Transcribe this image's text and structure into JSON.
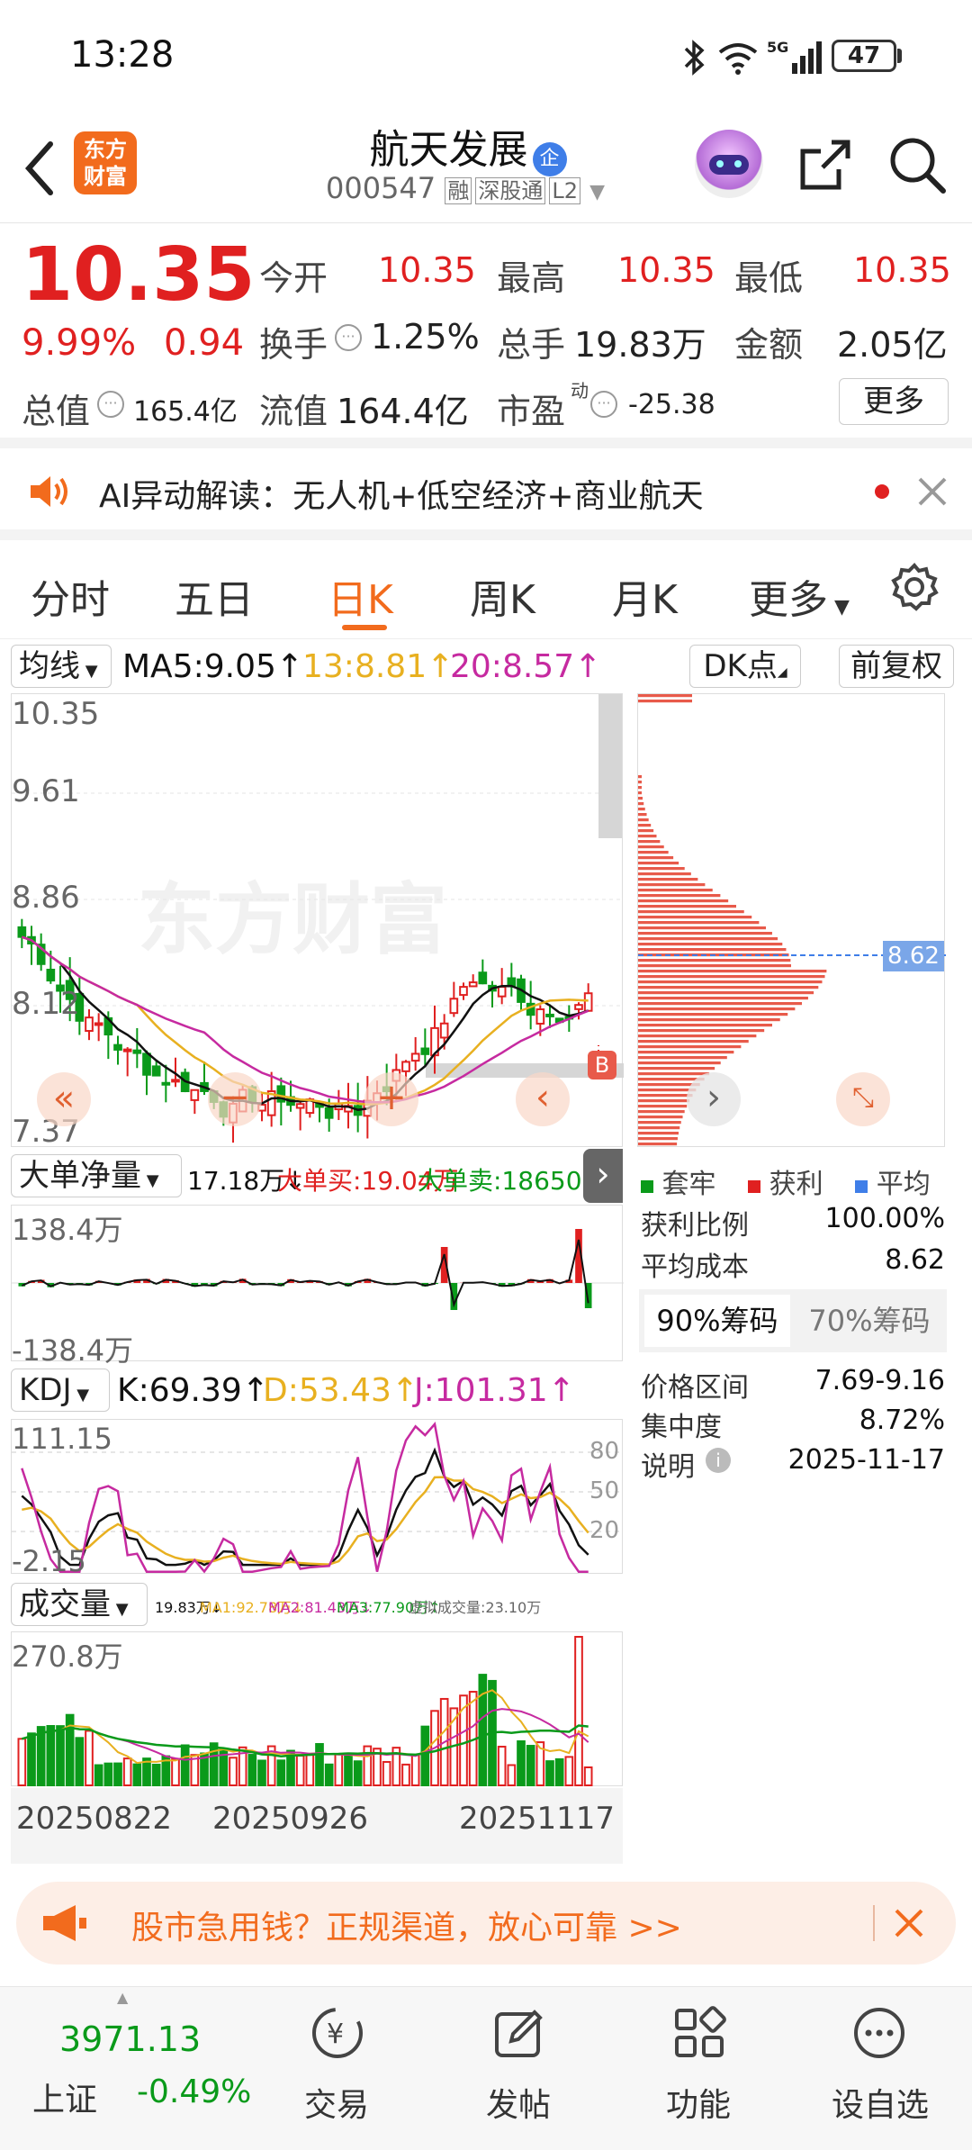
{
  "status": {
    "time": "13:28",
    "battery": "47"
  },
  "header": {
    "title": "航天发展",
    "title_badge": "企",
    "code": "000547",
    "tag1": "融",
    "tag2": "深股通",
    "tag3": "L2",
    "logo_l1": "东方",
    "logo_l2": "财富"
  },
  "quote": {
    "price": "10.35",
    "pct": "9.99%",
    "change": "0.94",
    "open_label": "今开",
    "open": "10.35",
    "high_label": "最高",
    "high": "10.35",
    "low_label": "最低",
    "low": "10.35",
    "turnover_label": "换手",
    "turnover": "1.25%",
    "volume_label": "总手",
    "volume": "19.83万",
    "amount_label": "金额",
    "amount": "2.05亿",
    "mcap_label": "总值",
    "mcap": "165.4亿",
    "float_label": "流值",
    "float": "164.4亿",
    "pe_label": "市盈",
    "pe_sup": "动",
    "pe": "-25.38",
    "more": "更多"
  },
  "ai_banner": {
    "text": "AI异动解读：无人机+低空经济+商业航天"
  },
  "tabs": [
    {
      "label": "分时",
      "active": false
    },
    {
      "label": "五日",
      "active": false
    },
    {
      "label": "日K",
      "active": true
    },
    {
      "label": "周K",
      "active": false
    },
    {
      "label": "月K",
      "active": false
    },
    {
      "label": "更多",
      "active": false
    }
  ],
  "ma_bar": {
    "select": "均线",
    "ma5": "MA5:9.05↑",
    "ma13": "13:8.81↑",
    "ma20": "20:8.57↑",
    "dk": "DK点",
    "fq": "前复权"
  },
  "price_axis": [
    "10.35",
    "9.61",
    "8.86",
    "8.12",
    "7.37"
  ],
  "watermark": "东方财富",
  "b_marker": "B",
  "bigorder": {
    "select": "大单净量",
    "net": "17.18万↓",
    "buy": "大单买:19.04万",
    "sell": "大单卖:18650",
    "top": "138.4万",
    "bottom": "-138.4万"
  },
  "kdj": {
    "select": "KDJ",
    "k": "K:69.39↑",
    "d": "D:53.43↑",
    "j": "J:101.31↑",
    "top": "111.15",
    "bottom": "-2.15",
    "lv80": "80",
    "lv50": "50",
    "lv20": "20"
  },
  "volume": {
    "select": "成交量",
    "vol": "19.83万↓",
    "ma1": "MA1:92.78万↓",
    "ma2": "MA2:81.43万↓",
    "ma3": "MA3:77.90万↑",
    "virtual": "虚拟成交量:23.10万",
    "top": "270.8万"
  },
  "dates": [
    "20250822",
    "20250926",
    "20251117"
  ],
  "chips": {
    "avg_price": "8.62",
    "legend": [
      "套牢",
      "获利",
      "平均"
    ],
    "profit_ratio_label": "获利比例",
    "profit_ratio": "100.00%",
    "avg_cost_label": "平均成本",
    "avg_cost": "8.62",
    "tab90": "90%筹码",
    "tab70": "70%筹码",
    "range_label": "价格区间",
    "range": "7.69-9.16",
    "conc_label": "集中度",
    "conc": "8.72%",
    "note_label": "说明",
    "note_date": "2025-11-17"
  },
  "ad": {
    "text": "股市急用钱？正规渠道，放心可靠 >>"
  },
  "bottom": {
    "index_value": "3971.13",
    "index_name": "上证",
    "index_pct": "-0.49%",
    "trade": "交易",
    "post": "发帖",
    "func": "功能",
    "watch": "设自选"
  },
  "colors": {
    "up": "#e02020",
    "down": "#0a9a1a",
    "accent": "#f26b1d",
    "ma13": "#e8b020",
    "ma20": "#c62aa0"
  }
}
